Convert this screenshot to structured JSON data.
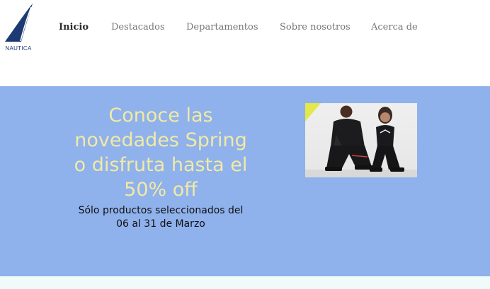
{
  "brand": {
    "logo_text": "NAUTICA",
    "color": "#1d3a72"
  },
  "nav": {
    "items": [
      {
        "label": "Inicio",
        "active": true
      },
      {
        "label": "Destacados",
        "active": false
      },
      {
        "label": "Departamentos",
        "active": false
      },
      {
        "label": "Sobre nosotros",
        "active": false
      },
      {
        "label": "Acerca de",
        "active": false
      }
    ]
  },
  "hero": {
    "headline_lines": [
      "Conoce las",
      "novedades Spring",
      "o disfruta hasta el",
      "50% off"
    ],
    "subline_lines": [
      "Sólo productos seleccionados del",
      "06 al 31 de Marzo"
    ],
    "background_color": "#8fb1ec",
    "headline_color": "#f1eaa4",
    "photo_icon": "fashion-models-photo"
  }
}
